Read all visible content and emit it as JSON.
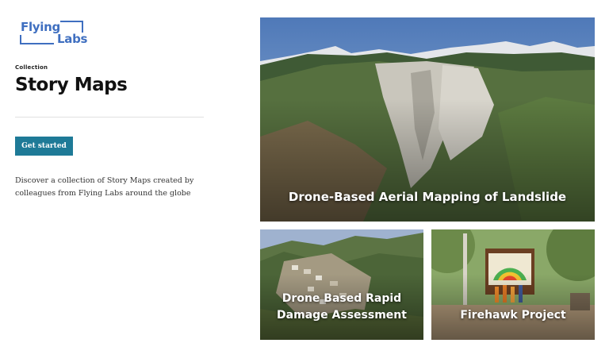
{
  "logo": {
    "line1": "Flying",
    "line2": "Labs"
  },
  "header": {
    "eyebrow": "Collection",
    "title": "Story Maps"
  },
  "cta": {
    "label": "Get started"
  },
  "description": "Discover a collection of Story Maps created by colleagues from Flying Labs around the globe",
  "cards": [
    {
      "title": "Drone-Based Aerial Mapping of Landslide"
    },
    {
      "title": "Drone Based Rapid Damage Assessment"
    },
    {
      "title": "Firehawk Project"
    }
  ],
  "colors": {
    "accent": "#1e7a97",
    "logo": "#3f6fc0"
  }
}
